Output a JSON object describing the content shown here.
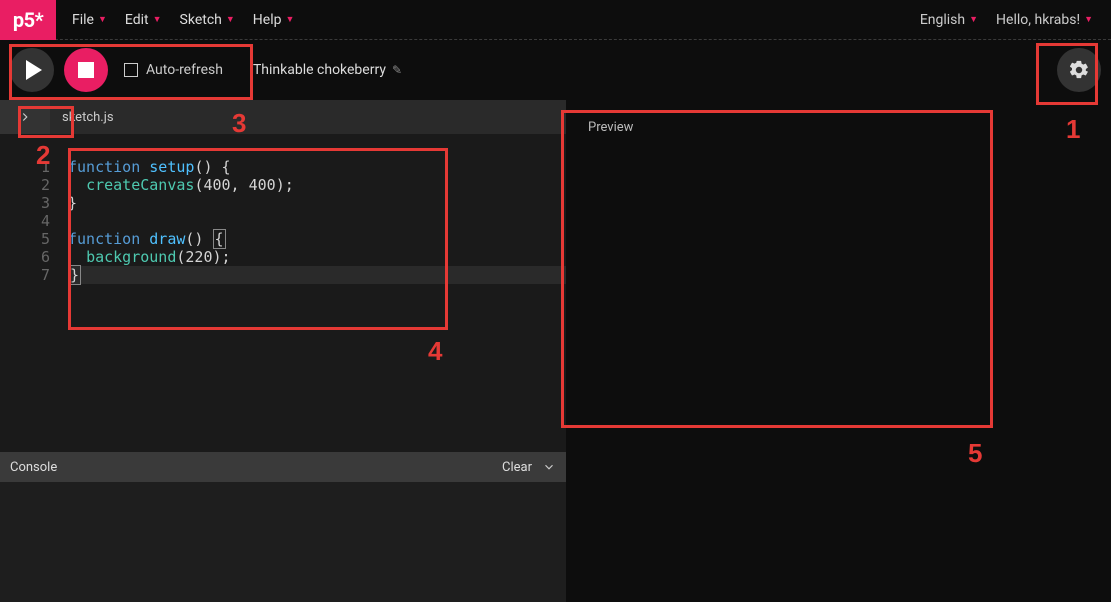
{
  "logo": "p5*",
  "menus": {
    "file": "File",
    "edit": "Edit",
    "sketch": "Sketch",
    "help": "Help"
  },
  "right_menus": {
    "language": "English",
    "greeting": "Hello, hkrabs!"
  },
  "toolbar": {
    "auto_refresh_label": "Auto-refresh",
    "sketch_name": "Thinkable chokeberry"
  },
  "file_tab": "sketch.js",
  "code_lines": {
    "l1_kw": "function",
    "l1_fn": "setup",
    "l1_rest": "() {",
    "l2_fn": "createCanvas",
    "l2_args": "(400, 400);",
    "l3": "}",
    "l5_kw": "function",
    "l5_fn": "draw",
    "l5_paren": "()",
    "l5_brace": "{",
    "l6_fn": "background",
    "l6_args": "(220);",
    "l7": "}"
  },
  "gutter": [
    "1",
    "2",
    "3",
    "4",
    "5",
    "6",
    "7"
  ],
  "preview_label": "Preview",
  "console": {
    "title": "Console",
    "clear": "Clear"
  },
  "annotations": {
    "a1": "1",
    "a2": "2",
    "a3": "3",
    "a4": "4",
    "a5": "5"
  }
}
